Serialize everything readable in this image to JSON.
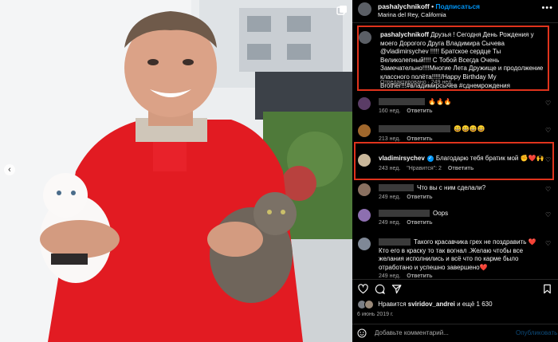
{
  "header": {
    "username": "pashalychnikoff",
    "separator": " • ",
    "follow_label": "Подписаться",
    "location": "Marina del Rey, California",
    "more_icon": "more-horizontal-icon"
  },
  "caption": {
    "username": "pashalychnikoff",
    "text": "Друзья ! Сегодня День Рождения у моего Дорогого Друга Владимира Сычева @vladimirsychev !!!!! Братское сердце Ты Великолепный!!!! С Тобой Всегда Очень Замечательно!!!!Многие Лета Дружище и продолжение классного полёта!!!!!/Happy Birthday My Brother!!!#владимирсычев #сднемрождения",
    "meta": "Отредактировано · 249 нед."
  },
  "comments": [
    {
      "text": "🔥🔥🔥",
      "time": "160 нед.",
      "reply": "Ответить"
    },
    {
      "text": "😄😄😄😄",
      "time": "213 нед.",
      "reply": "Ответить"
    },
    {
      "username": "vladimirsychev",
      "text": "Благодарю тебя братик мой ✊❤️🙌",
      "time": "243 нед.",
      "likes": "\"Нравится\": 2",
      "reply": "Ответить"
    },
    {
      "text": "Что вы с ним сделали?",
      "time": "249 нед.",
      "reply": "Ответить"
    },
    {
      "text": "Oops",
      "time": "249 нед.",
      "reply": "Ответить"
    },
    {
      "text": "Такого красавчика грех не поздравить ❤️ Кто его в краску то так вогнал .Желаю чтобы все желания исполнились и всё что по карме было отработано и успешно завершено❤️",
      "time": "249 нед.",
      "reply": "Ответить"
    }
  ],
  "likes": {
    "prefix": "Нравится ",
    "user": "sviridov_andrei",
    "suffix": " и ещё 1 630"
  },
  "date": "6 июнь 2019 г.",
  "composer": {
    "placeholder": "Добавьте комментарий...",
    "publish_label": "Опубликовать"
  },
  "colors": {
    "accent": "#0095f6",
    "highlight_border": "#e0331c",
    "shirt": "#e21b22"
  }
}
